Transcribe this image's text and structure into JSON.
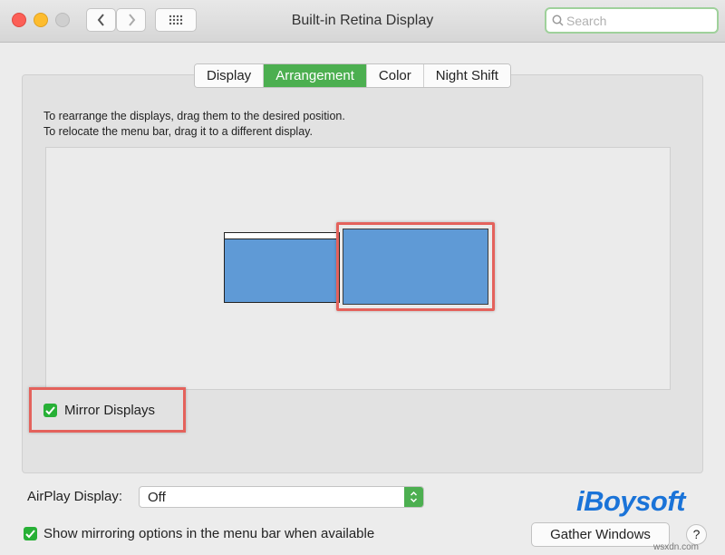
{
  "window": {
    "title": "Built-in Retina Display"
  },
  "search": {
    "placeholder": "Search"
  },
  "tabs": [
    {
      "label": "Display",
      "active": false
    },
    {
      "label": "Arrangement",
      "active": true
    },
    {
      "label": "Color",
      "active": false
    },
    {
      "label": "Night Shift",
      "active": false
    }
  ],
  "instructions": {
    "line1": "To rearrange the displays, drag them to the desired position.",
    "line2": "To relocate the menu bar, drag it to a different display."
  },
  "mirror": {
    "label": "Mirror Displays",
    "checked": true
  },
  "airplay": {
    "label": "AirPlay Display:",
    "value": "Off"
  },
  "show_mirroring": {
    "label": "Show mirroring options in the menu bar when available",
    "checked": true
  },
  "gather_button": {
    "label": "Gather Windows"
  },
  "help_button": {
    "label": "?"
  },
  "logo": {
    "text": "iBoysoft"
  },
  "watermark": {
    "text": "wsxdn.com"
  },
  "colors": {
    "accent": "#4caf50",
    "highlight": "#e4625c",
    "display": "#5f9ad6",
    "logo": "#1a73d8"
  }
}
